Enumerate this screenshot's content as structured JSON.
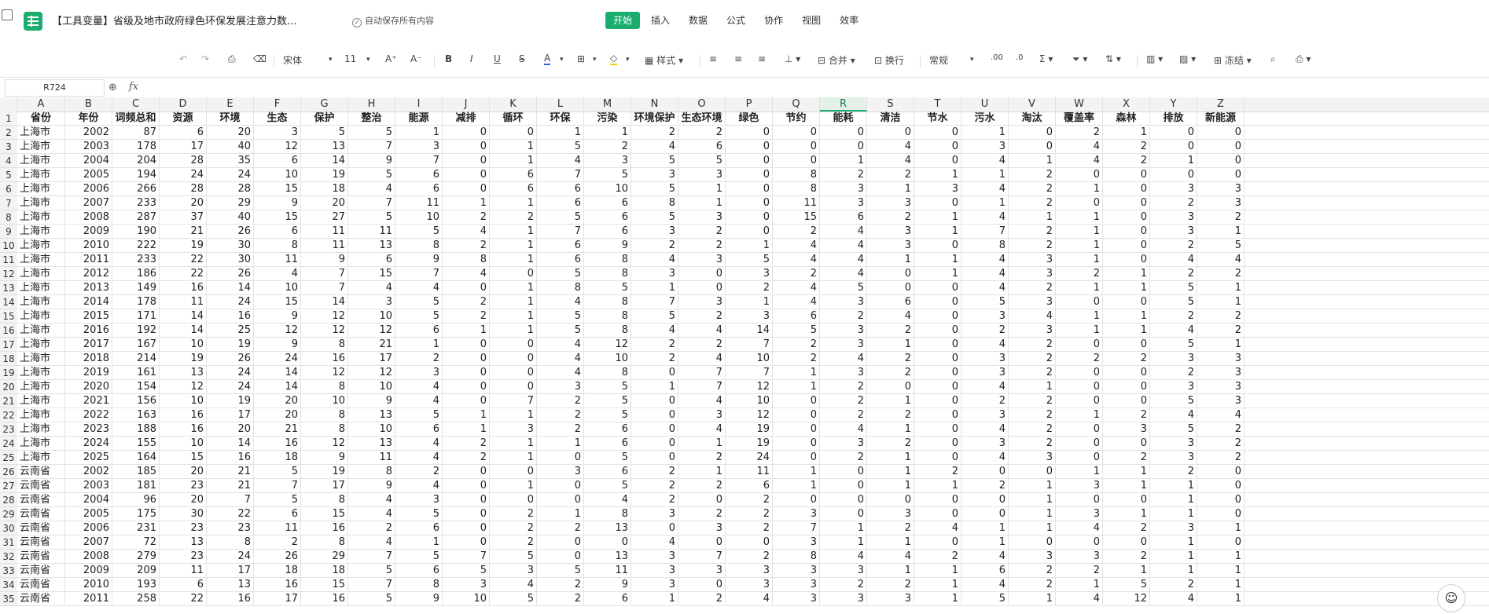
{
  "doc_title": "【工具变量】省级及地市政府绿色环保发展注意力数...",
  "autosave_text": "自动保存所有内容",
  "menu": [
    "开始",
    "插入",
    "数据",
    "公式",
    "协作",
    "视图",
    "效率"
  ],
  "active_menu": "开始",
  "toolbar": {
    "font": "宋体",
    "size": "11",
    "styles_label": "样式",
    "merge_label": "合并",
    "wrap_label": "换行",
    "format_label": "常规",
    "freeze_label": "冻结"
  },
  "namebox": "R724",
  "fx_label": "fx",
  "selected_column": "R",
  "column_letters": [
    "A",
    "B",
    "C",
    "D",
    "E",
    "F",
    "G",
    "H",
    "I",
    "J",
    "K",
    "L",
    "M",
    "N",
    "O",
    "P",
    "Q",
    "R",
    "S",
    "T",
    "U",
    "V",
    "W",
    "X",
    "Y",
    "Z"
  ],
  "header_row": [
    "省份",
    "年份",
    "词频总和",
    "资源",
    "环境",
    "生态",
    "保护",
    "整治",
    "能源",
    "减排",
    "循环",
    "环保",
    "污染",
    "环境保护",
    "生态环境",
    "绿色",
    "节约",
    "能耗",
    "清洁",
    "节水",
    "污水",
    "淘汰",
    "覆盖率",
    "森林",
    "排放",
    "新能源"
  ],
  "rows": [
    [
      "上海市",
      "2002",
      "87",
      "6",
      "20",
      "3",
      "5",
      "5",
      "1",
      "0",
      "0",
      "1",
      "1",
      "2",
      "2",
      "0",
      "0",
      "0",
      "0",
      "0",
      "1",
      "0",
      "2",
      "1",
      "0",
      "0"
    ],
    [
      "上海市",
      "2003",
      "178",
      "17",
      "40",
      "12",
      "13",
      "7",
      "3",
      "0",
      "1",
      "5",
      "2",
      "4",
      "6",
      "0",
      "0",
      "0",
      "4",
      "0",
      "3",
      "0",
      "4",
      "2",
      "0",
      "0"
    ],
    [
      "上海市",
      "2004",
      "204",
      "28",
      "35",
      "6",
      "14",
      "9",
      "7",
      "0",
      "1",
      "4",
      "3",
      "5",
      "5",
      "0",
      "0",
      "1",
      "4",
      "0",
      "4",
      "1",
      "4",
      "2",
      "1",
      "0"
    ],
    [
      "上海市",
      "2005",
      "194",
      "24",
      "24",
      "10",
      "19",
      "5",
      "6",
      "0",
      "6",
      "7",
      "5",
      "3",
      "3",
      "0",
      "8",
      "2",
      "2",
      "1",
      "1",
      "2",
      "0",
      "0",
      "0",
      "0"
    ],
    [
      "上海市",
      "2006",
      "266",
      "28",
      "28",
      "15",
      "18",
      "4",
      "6",
      "0",
      "6",
      "6",
      "10",
      "5",
      "1",
      "0",
      "8",
      "3",
      "1",
      "3",
      "4",
      "2",
      "1",
      "0",
      "3",
      "3"
    ],
    [
      "上海市",
      "2007",
      "233",
      "20",
      "29",
      "9",
      "20",
      "7",
      "11",
      "1",
      "1",
      "6",
      "6",
      "8",
      "1",
      "0",
      "11",
      "3",
      "3",
      "0",
      "1",
      "2",
      "0",
      "0",
      "2",
      "3"
    ],
    [
      "上海市",
      "2008",
      "287",
      "37",
      "40",
      "15",
      "27",
      "5",
      "10",
      "2",
      "2",
      "5",
      "6",
      "5",
      "3",
      "0",
      "15",
      "6",
      "2",
      "1",
      "4",
      "1",
      "1",
      "0",
      "3",
      "2"
    ],
    [
      "上海市",
      "2009",
      "190",
      "21",
      "26",
      "6",
      "11",
      "11",
      "5",
      "4",
      "1",
      "7",
      "6",
      "3",
      "2",
      "0",
      "2",
      "4",
      "3",
      "1",
      "7",
      "2",
      "1",
      "0",
      "3",
      "1"
    ],
    [
      "上海市",
      "2010",
      "222",
      "19",
      "30",
      "8",
      "11",
      "13",
      "8",
      "2",
      "1",
      "6",
      "9",
      "2",
      "2",
      "1",
      "4",
      "4",
      "3",
      "0",
      "8",
      "2",
      "1",
      "0",
      "2",
      "5"
    ],
    [
      "上海市",
      "2011",
      "233",
      "22",
      "30",
      "11",
      "9",
      "6",
      "9",
      "8",
      "1",
      "6",
      "8",
      "4",
      "3",
      "5",
      "4",
      "4",
      "1",
      "1",
      "4",
      "3",
      "1",
      "0",
      "4",
      "4"
    ],
    [
      "上海市",
      "2012",
      "186",
      "22",
      "26",
      "4",
      "7",
      "15",
      "7",
      "4",
      "0",
      "5",
      "8",
      "3",
      "0",
      "3",
      "2",
      "4",
      "0",
      "1",
      "4",
      "3",
      "2",
      "1",
      "2",
      "2"
    ],
    [
      "上海市",
      "2013",
      "149",
      "16",
      "14",
      "10",
      "7",
      "4",
      "4",
      "0",
      "1",
      "8",
      "5",
      "1",
      "0",
      "2",
      "4",
      "5",
      "0",
      "0",
      "4",
      "2",
      "1",
      "1",
      "5",
      "1"
    ],
    [
      "上海市",
      "2014",
      "178",
      "11",
      "24",
      "15",
      "14",
      "3",
      "5",
      "2",
      "1",
      "4",
      "8",
      "7",
      "3",
      "1",
      "4",
      "3",
      "6",
      "0",
      "5",
      "3",
      "0",
      "0",
      "5",
      "1"
    ],
    [
      "上海市",
      "2015",
      "171",
      "14",
      "16",
      "9",
      "12",
      "10",
      "5",
      "2",
      "1",
      "5",
      "8",
      "5",
      "2",
      "3",
      "6",
      "2",
      "4",
      "0",
      "3",
      "4",
      "1",
      "1",
      "2",
      "2"
    ],
    [
      "上海市",
      "2016",
      "192",
      "14",
      "25",
      "12",
      "12",
      "12",
      "6",
      "1",
      "1",
      "5",
      "8",
      "4",
      "4",
      "14",
      "5",
      "3",
      "2",
      "0",
      "2",
      "3",
      "1",
      "1",
      "4",
      "2"
    ],
    [
      "上海市",
      "2017",
      "167",
      "10",
      "19",
      "9",
      "8",
      "21",
      "1",
      "0",
      "0",
      "4",
      "12",
      "2",
      "2",
      "7",
      "2",
      "3",
      "1",
      "0",
      "4",
      "2",
      "0",
      "0",
      "5",
      "1"
    ],
    [
      "上海市",
      "2018",
      "214",
      "19",
      "26",
      "24",
      "16",
      "17",
      "2",
      "0",
      "0",
      "4",
      "10",
      "2",
      "4",
      "10",
      "2",
      "4",
      "2",
      "0",
      "3",
      "2",
      "2",
      "2",
      "3",
      "3"
    ],
    [
      "上海市",
      "2019",
      "161",
      "13",
      "24",
      "14",
      "12",
      "12",
      "3",
      "0",
      "0",
      "4",
      "8",
      "0",
      "7",
      "7",
      "1",
      "3",
      "2",
      "0",
      "3",
      "2",
      "0",
      "0",
      "2",
      "3"
    ],
    [
      "上海市",
      "2020",
      "154",
      "12",
      "24",
      "14",
      "8",
      "10",
      "4",
      "0",
      "0",
      "3",
      "5",
      "1",
      "7",
      "12",
      "1",
      "2",
      "0",
      "0",
      "4",
      "1",
      "0",
      "0",
      "3",
      "3"
    ],
    [
      "上海市",
      "2021",
      "156",
      "10",
      "19",
      "20",
      "10",
      "9",
      "4",
      "0",
      "7",
      "2",
      "5",
      "0",
      "4",
      "10",
      "0",
      "2",
      "1",
      "0",
      "2",
      "2",
      "0",
      "0",
      "5",
      "3"
    ],
    [
      "上海市",
      "2022",
      "163",
      "16",
      "17",
      "20",
      "8",
      "13",
      "5",
      "1",
      "1",
      "2",
      "5",
      "0",
      "3",
      "12",
      "0",
      "2",
      "2",
      "0",
      "3",
      "2",
      "1",
      "2",
      "4",
      "4"
    ],
    [
      "上海市",
      "2023",
      "188",
      "16",
      "20",
      "21",
      "8",
      "10",
      "6",
      "1",
      "3",
      "2",
      "6",
      "0",
      "4",
      "19",
      "0",
      "4",
      "1",
      "0",
      "4",
      "2",
      "0",
      "3",
      "5",
      "2"
    ],
    [
      "上海市",
      "2024",
      "155",
      "10",
      "14",
      "16",
      "12",
      "13",
      "4",
      "2",
      "1",
      "1",
      "6",
      "0",
      "1",
      "19",
      "0",
      "3",
      "2",
      "0",
      "3",
      "2",
      "0",
      "0",
      "3",
      "2"
    ],
    [
      "上海市",
      "2025",
      "164",
      "15",
      "16",
      "18",
      "9",
      "11",
      "4",
      "2",
      "1",
      "0",
      "5",
      "0",
      "2",
      "24",
      "0",
      "2",
      "1",
      "0",
      "4",
      "3",
      "0",
      "2",
      "3",
      "2"
    ],
    [
      "云南省",
      "2002",
      "185",
      "20",
      "21",
      "5",
      "19",
      "8",
      "2",
      "0",
      "0",
      "3",
      "6",
      "2",
      "1",
      "11",
      "1",
      "0",
      "1",
      "2",
      "0",
      "0",
      "1",
      "1",
      "2",
      "0"
    ],
    [
      "云南省",
      "2003",
      "181",
      "23",
      "21",
      "7",
      "17",
      "9",
      "4",
      "0",
      "1",
      "0",
      "5",
      "2",
      "2",
      "6",
      "1",
      "0",
      "1",
      "1",
      "2",
      "1",
      "3",
      "1",
      "1",
      "0"
    ],
    [
      "云南省",
      "2004",
      "96",
      "20",
      "7",
      "5",
      "8",
      "4",
      "3",
      "0",
      "0",
      "0",
      "4",
      "2",
      "0",
      "2",
      "0",
      "0",
      "0",
      "0",
      "0",
      "1",
      "0",
      "0",
      "1",
      "0"
    ],
    [
      "云南省",
      "2005",
      "175",
      "30",
      "22",
      "6",
      "15",
      "4",
      "5",
      "0",
      "2",
      "1",
      "8",
      "3",
      "2",
      "2",
      "3",
      "0",
      "3",
      "0",
      "0",
      "1",
      "3",
      "1",
      "1",
      "0"
    ],
    [
      "云南省",
      "2006",
      "231",
      "23",
      "23",
      "11",
      "16",
      "2",
      "6",
      "0",
      "2",
      "2",
      "13",
      "0",
      "3",
      "2",
      "7",
      "1",
      "2",
      "4",
      "1",
      "1",
      "4",
      "2",
      "3",
      "1"
    ],
    [
      "云南省",
      "2007",
      "72",
      "13",
      "8",
      "2",
      "8",
      "4",
      "1",
      "0",
      "2",
      "0",
      "0",
      "4",
      "0",
      "0",
      "3",
      "1",
      "1",
      "0",
      "1",
      "0",
      "0",
      "0",
      "1",
      "0"
    ],
    [
      "云南省",
      "2008",
      "279",
      "23",
      "24",
      "26",
      "29",
      "7",
      "5",
      "7",
      "5",
      "0",
      "13",
      "3",
      "7",
      "2",
      "8",
      "4",
      "4",
      "2",
      "4",
      "3",
      "3",
      "2",
      "1",
      "1"
    ],
    [
      "云南省",
      "2009",
      "209",
      "11",
      "17",
      "18",
      "18",
      "5",
      "6",
      "5",
      "3",
      "5",
      "11",
      "3",
      "3",
      "3",
      "3",
      "3",
      "1",
      "1",
      "6",
      "2",
      "2",
      "1",
      "1",
      "1"
    ],
    [
      "云南省",
      "2010",
      "193",
      "6",
      "13",
      "16",
      "15",
      "7",
      "8",
      "3",
      "4",
      "2",
      "9",
      "3",
      "0",
      "3",
      "3",
      "2",
      "2",
      "1",
      "4",
      "2",
      "1",
      "5",
      "2",
      "1"
    ],
    [
      "云南省",
      "2011",
      "258",
      "22",
      "16",
      "17",
      "16",
      "5",
      "9",
      "10",
      "5",
      "2",
      "6",
      "1",
      "2",
      "4",
      "3",
      "3",
      "3",
      "1",
      "5",
      "1",
      "4",
      "12",
      "4",
      "1"
    ]
  ]
}
